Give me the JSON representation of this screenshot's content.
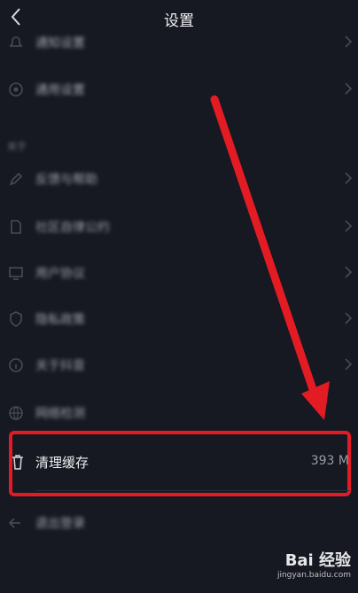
{
  "header": {
    "title": "设置"
  },
  "rows": [
    {
      "label": "通知设置",
      "icon": "bell-icon"
    },
    {
      "label": "通用设置",
      "icon": "settings-icon"
    },
    {
      "label": "反馈与帮助",
      "icon": "pen-icon"
    },
    {
      "label": "社区自律公约",
      "icon": "document-icon"
    },
    {
      "label": "用户协议",
      "icon": "monitor-icon"
    },
    {
      "label": "隐私政策",
      "icon": "shield-icon"
    },
    {
      "label": "关于抖音",
      "icon": "info-icon"
    },
    {
      "label": "网络检测",
      "icon": "network-icon"
    }
  ],
  "section_label": "关于",
  "cache": {
    "label": "清理缓存",
    "size": "393 M",
    "icon": "trash-icon"
  },
  "logout": {
    "label": "退出登录",
    "icon": "logout-icon"
  },
  "watermark": {
    "logo": "Bai 经验",
    "url": "jingyan.baidu.com"
  },
  "colors": {
    "background": "#161822",
    "highlight": "#e31b23",
    "text": "#f0f0f2",
    "muted": "#9a9ba4"
  }
}
